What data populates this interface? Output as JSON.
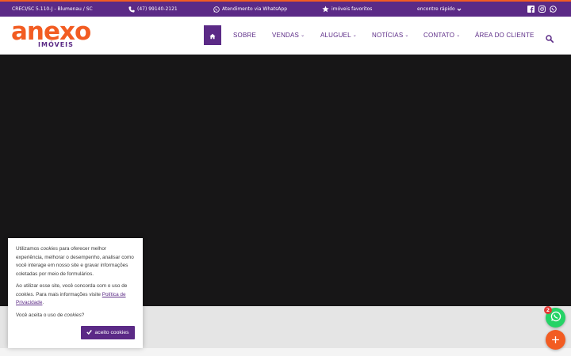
{
  "colors": {
    "brand_purple": "#5b2a86",
    "brand_orange": "#f25c22",
    "hero_bg": "#171617",
    "whatsapp_green": "#25d366"
  },
  "topbar": {
    "creci": "CRECI/SC 5.110-J - Blumenau / SC",
    "phone": "(47) 99140-2121",
    "whatsapp": "Atendimento via WhatsApp",
    "favorites": "imóveis favoritos",
    "quick_find": "encontre rápido"
  },
  "header": {
    "logo": "anexo",
    "logo_sub": "IMÓVEIS",
    "nav": {
      "sobre": "SOBRE",
      "vendas": "VENDAS",
      "aluguel": "ALUGUEL",
      "noticias": "NOTÍCIAS",
      "contato": "CONTATO",
      "area_cliente": "ÁREA DO CLIENTE"
    },
    "icons": [
      "home-icon",
      "search-icon",
      "facebook-icon",
      "instagram-icon",
      "whatsapp-icon"
    ]
  },
  "cookie": {
    "p1_a": "Utilizamos ",
    "p1_em": "cookies",
    "p1_b": " para oferecer melhor experiência, melhorar o desempenho, analisar como você interage em nosso site e gravar informações coletadas por meio de formulários.",
    "p2_a": "Ao utilizar esse site, você concorda com o uso de ",
    "p2_em": "cookies",
    "p2_b": ". Para mais informações visite ",
    "p2_link": "Política de Privacidade",
    "p2_end": ".",
    "p3_a": "Você aceita o uso de ",
    "p3_em": "cookies",
    "p3_b": "?",
    "accept": "aceito cookies"
  },
  "floating": {
    "whatsapp_badge": "2"
  }
}
